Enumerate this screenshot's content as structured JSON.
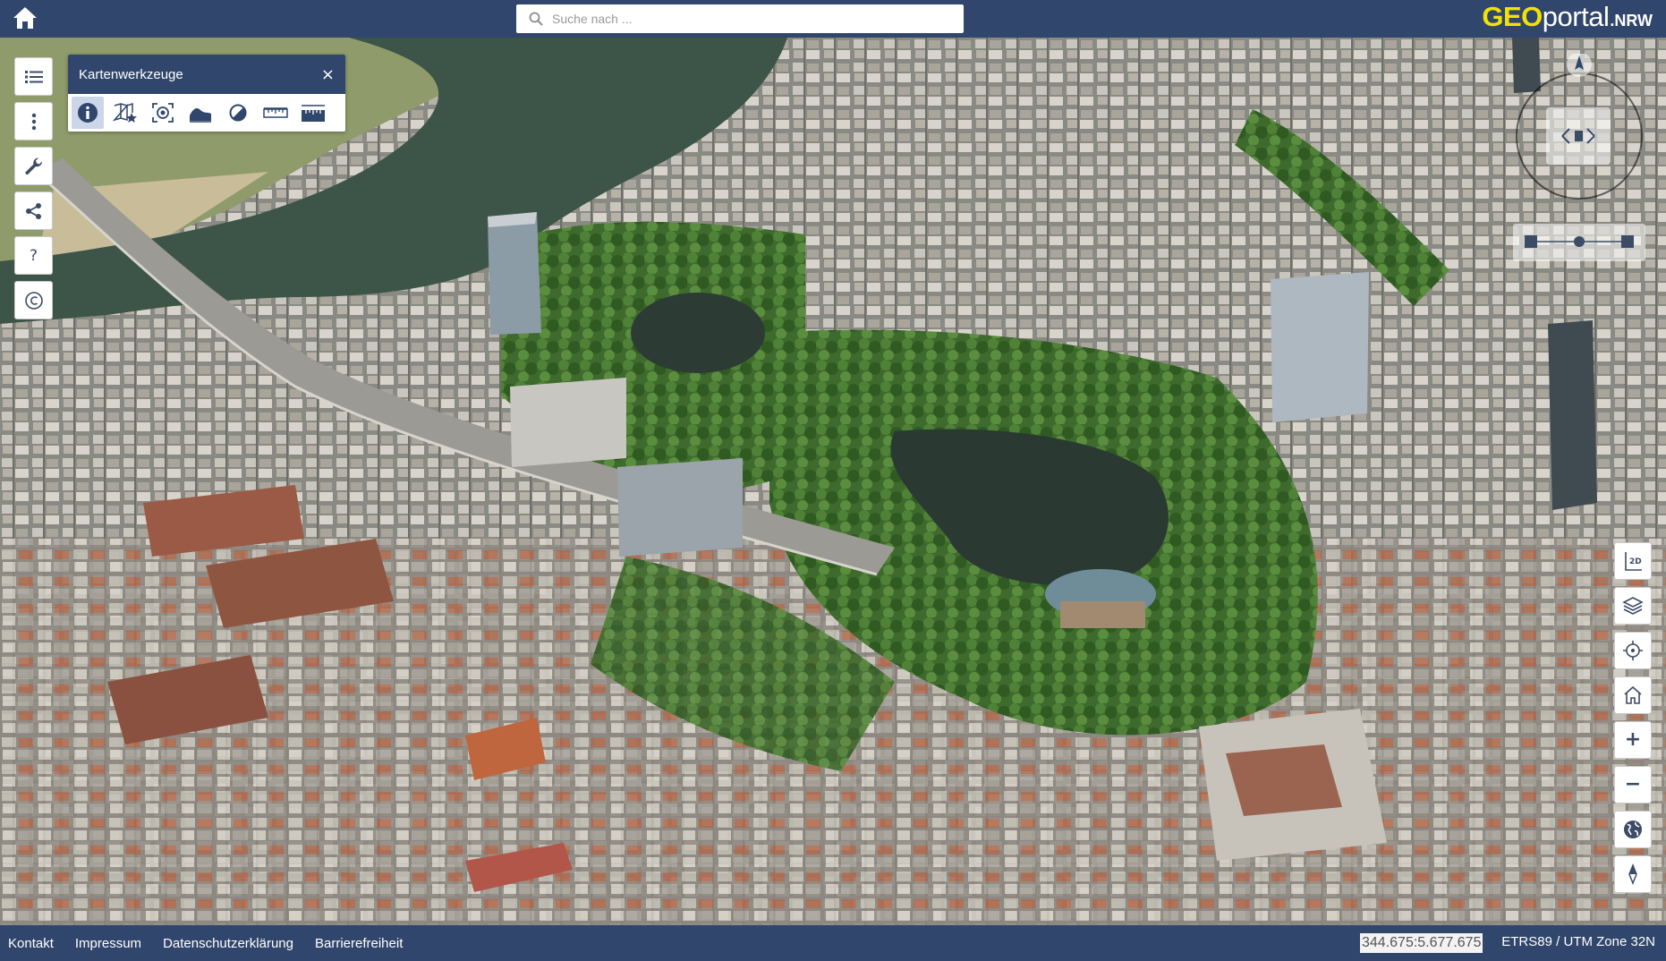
{
  "header": {
    "search": {
      "placeholder": "Suche nach ..."
    },
    "logo": {
      "part1": "GEO",
      "part2": "portal",
      "part3": ".NRW"
    }
  },
  "left_toolbar": {
    "help_label": "?",
    "copyright_label": "©"
  },
  "tools_panel": {
    "title": "Kartenwerkzeuge",
    "close_label": "×",
    "tools": [
      "info",
      "add-placemark",
      "viewshed",
      "height-profile",
      "shadow",
      "measure-distance",
      "measure-height"
    ]
  },
  "right_toolbar": {
    "view_2d_label": "2D",
    "zoom_in_label": "+",
    "zoom_out_label": "−"
  },
  "footer": {
    "links": [
      "Kontakt",
      "Impressum",
      "Datenschutzerklärung",
      "Barrierefreiheit"
    ],
    "coordinates": "344.675:5.677.675",
    "crs": "ETRS89 / UTM Zone 32N"
  },
  "colors": {
    "brand_blue": "#30466c",
    "logo_yellow": "#f2e200",
    "active_tool": "#cbd6e9"
  }
}
